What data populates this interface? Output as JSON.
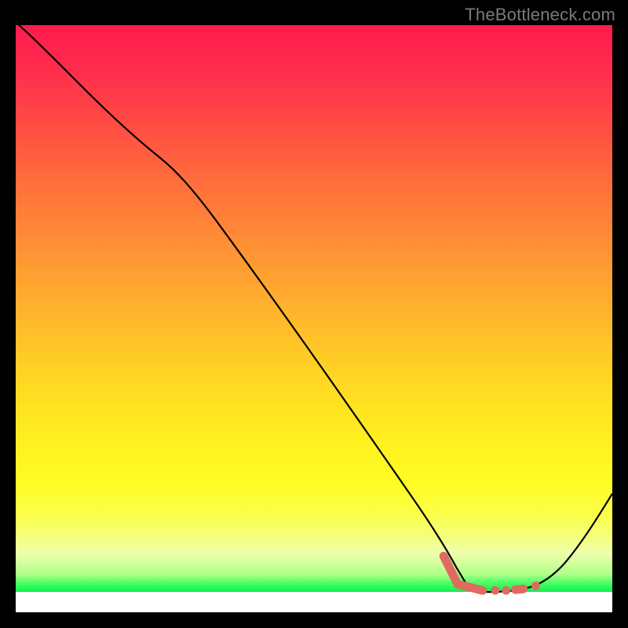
{
  "watermark": "TheBottleneck.com",
  "chart_data": {
    "type": "line",
    "title": "",
    "xlabel": "",
    "ylabel": "",
    "xlim": [
      0,
      100
    ],
    "ylim": [
      0,
      100
    ],
    "series": [
      {
        "name": "bottleneck-curve",
        "x": [
          0,
          10,
          18,
          25,
          32,
          40,
          48,
          56,
          64,
          72,
          76,
          80,
          84,
          88,
          92,
          96,
          100
        ],
        "y": [
          100,
          94,
          88,
          82,
          72,
          60,
          48,
          36,
          24,
          12,
          6,
          2,
          0,
          0,
          4,
          12,
          24
        ]
      }
    ],
    "optimum_region": {
      "name": "optimum-highlight",
      "x_start": 72,
      "x_end": 86,
      "y": 0
    },
    "background_gradient": {
      "stops": [
        "#ff1a4d",
        "#ffe021",
        "#2eff5a"
      ],
      "direction": "top-to-bottom",
      "meaning": "high-to-low bottleneck"
    }
  }
}
